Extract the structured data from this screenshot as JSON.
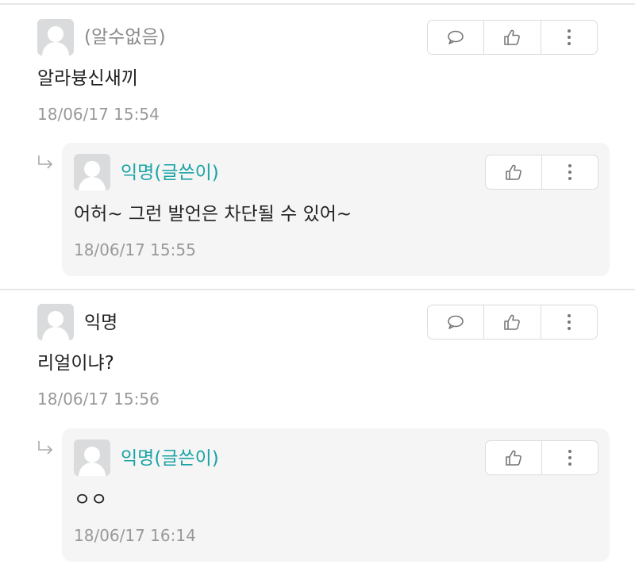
{
  "comments": [
    {
      "author": "(알수없음)",
      "content": "알라븅신새끼",
      "date": "18/06/17 15:54",
      "reply": {
        "author": "익명(글쓴이)",
        "content": "어허~ 그런 발언은 차단될 수 있어~",
        "date": "18/06/17 15:55"
      }
    },
    {
      "author": "익명",
      "content": "리얼이냐?",
      "date": "18/06/17 15:56",
      "reply": {
        "author": "익명(글쓴이)",
        "content": "ㅇㅇ",
        "date": "18/06/17 16:14"
      }
    }
  ],
  "icons": {
    "reply": "speech-bubble-icon",
    "like": "thumbs-up-icon",
    "more": "vertical-dots-icon",
    "reply_indicator": "reply-arrow-icon",
    "avatar": "default-avatar"
  },
  "colors": {
    "op_author": "#1aa3a6",
    "deleted_author": "#8a8a8a",
    "reply_background": "#f5f5f5",
    "date": "#999999"
  }
}
